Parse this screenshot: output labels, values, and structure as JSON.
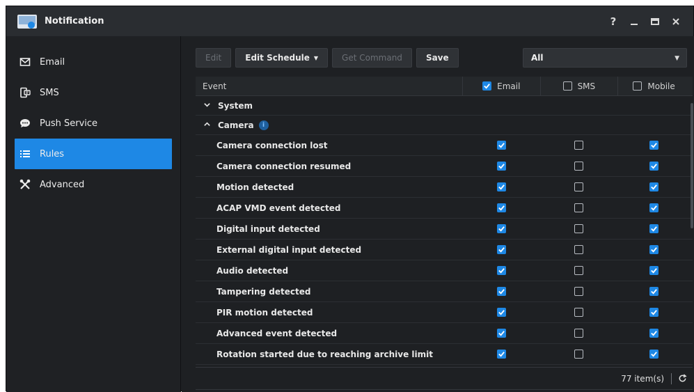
{
  "window": {
    "title": "Notification",
    "controls": {
      "help": "?",
      "minimize": "—",
      "maximize": "▬",
      "close": "✕"
    }
  },
  "sidebar": {
    "items": [
      {
        "label": "Email",
        "icon": "envelope-icon",
        "active": false
      },
      {
        "label": "SMS",
        "icon": "sms-phone-icon",
        "active": false
      },
      {
        "label": "Push Service",
        "icon": "chat-bubble-icon",
        "active": false
      },
      {
        "label": "Rules",
        "icon": "list-icon",
        "active": true
      },
      {
        "label": "Advanced",
        "icon": "tools-icon",
        "active": false
      }
    ]
  },
  "toolbar": {
    "edit_label": "Edit",
    "edit_schedule_label": "Edit Schedule",
    "get_command_label": "Get Command",
    "save_label": "Save"
  },
  "filter": {
    "selected": "All"
  },
  "table": {
    "headers": {
      "event": "Event",
      "email": "Email",
      "sms": "SMS",
      "mobile": "Mobile"
    },
    "header_checks": {
      "email": true,
      "sms": false,
      "mobile": false
    },
    "groups": [
      {
        "label": "System",
        "expanded": false
      },
      {
        "label": "Camera",
        "expanded": true,
        "info": "i"
      }
    ],
    "rows": [
      {
        "event": "Camera connection lost",
        "email": true,
        "sms": false,
        "mobile": true
      },
      {
        "event": "Camera connection resumed",
        "email": true,
        "sms": false,
        "mobile": true
      },
      {
        "event": "Motion detected",
        "email": true,
        "sms": false,
        "mobile": true
      },
      {
        "event": "ACAP VMD event detected",
        "email": true,
        "sms": false,
        "mobile": true
      },
      {
        "event": "Digital input detected",
        "email": true,
        "sms": false,
        "mobile": true
      },
      {
        "event": "External digital input detected",
        "email": true,
        "sms": false,
        "mobile": true
      },
      {
        "event": "Audio detected",
        "email": true,
        "sms": false,
        "mobile": true
      },
      {
        "event": "Tampering detected",
        "email": true,
        "sms": false,
        "mobile": true
      },
      {
        "event": "PIR motion detected",
        "email": true,
        "sms": false,
        "mobile": true
      },
      {
        "event": "Advanced event detected",
        "email": true,
        "sms": false,
        "mobile": true
      },
      {
        "event": "Rotation started due to reaching archive limit",
        "email": true,
        "sms": false,
        "mobile": true
      }
    ]
  },
  "footer": {
    "count": "77 item(s)"
  },
  "colors": {
    "accent": "#1e88e5",
    "background": "#1e2023",
    "titlebar": "#2a2d31"
  }
}
